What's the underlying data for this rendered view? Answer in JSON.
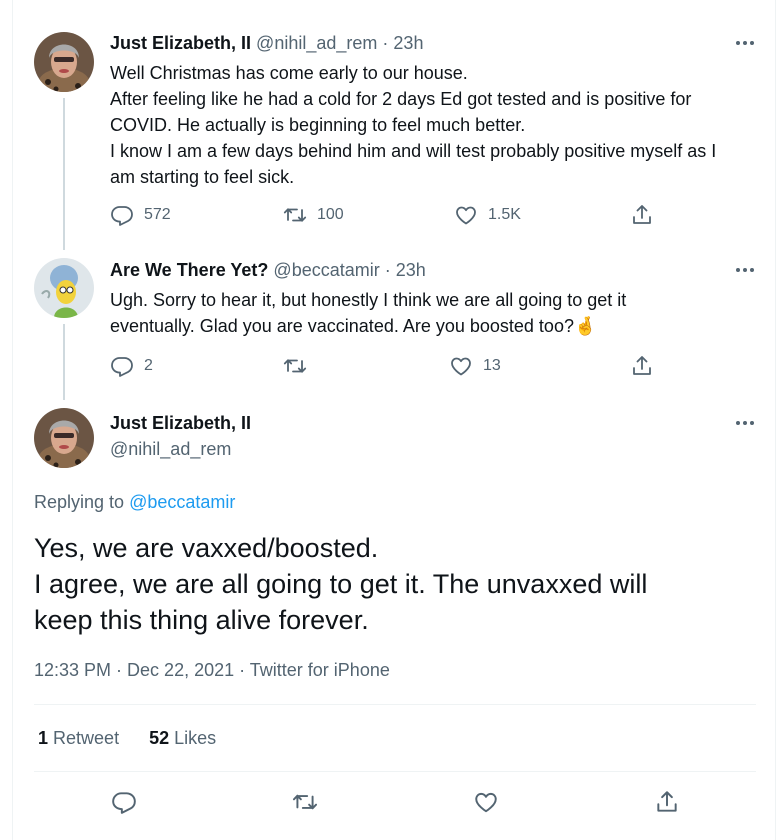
{
  "colors": {
    "accent": "#1d9bf0",
    "muted": "#536471",
    "text": "#0f1419",
    "line": "#cfd9de"
  },
  "tweet1": {
    "name": "Just Elizabeth, II",
    "handle": "@nihil_ad_rem",
    "time": "23h",
    "lines": [
      "Well Christmas has come early to our house.",
      "After feeling like he had a cold for 2 days Ed got tested and is positive for",
      "COVID. He actually is beginning to feel much better.",
      "I know I am a few days behind him and will test probably positive myself as I",
      "am starting to feel sick."
    ],
    "replies": "572",
    "retweets": "100",
    "likes": "1.5K"
  },
  "tweet2": {
    "name": "Are We There Yet?",
    "handle": "@beccatamir",
    "time": "23h",
    "line1": "Ugh. Sorry to hear it, but honestly I think we are all going to get it",
    "line2": "eventually. Glad you are vaccinated. Are you boosted too?",
    "emoji": "🤞",
    "replies": "2",
    "retweets": "",
    "likes": "13"
  },
  "main": {
    "name": "Just Elizabeth, II",
    "handle": "@nihil_ad_rem",
    "replying_prefix": "Replying to",
    "replying_handle": "@beccatamir",
    "lines": [
      "Yes, we are vaxxed/boosted.",
      "I agree, we are all going to get it. The unvaxxed will",
      "keep this thing alive forever."
    ],
    "meta": "12:33 PM · Dec 22, 2021 · Twitter for iPhone",
    "retweet_count": "1",
    "retweet_label": "Retweet",
    "like_count": "52",
    "like_label": "Likes"
  },
  "icons": {
    "reply": "reply-icon",
    "retweet": "retweet-icon",
    "like": "heart-icon",
    "share": "share-icon",
    "more": "more-icon"
  }
}
